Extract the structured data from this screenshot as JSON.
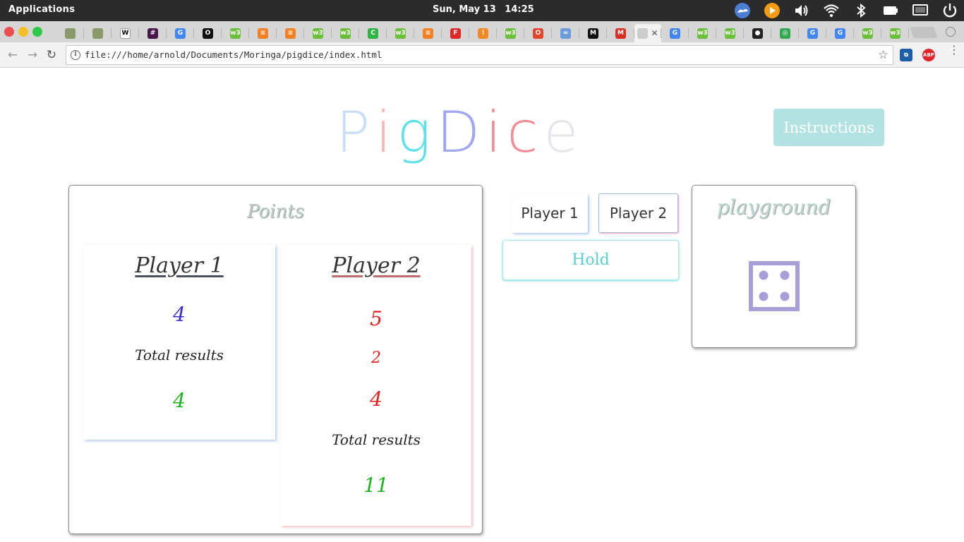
{
  "os": {
    "apps_label": "Applications",
    "date": "Sun, May 13",
    "time": "14:25",
    "tray_icons": [
      "weather-icon",
      "media-player-icon",
      "volume-icon",
      "wifi-icon",
      "bluetooth-icon",
      "battery-icon",
      "display-icon",
      "power-icon"
    ]
  },
  "browser": {
    "tab_favicons": [
      {
        "icon": "tree-icon",
        "color": "#8a9a6a",
        "text": ""
      },
      {
        "icon": "tree-icon",
        "color": "#8a9a6a",
        "text": ""
      },
      {
        "icon": "wikipedia-icon",
        "color": "#ffffff",
        "text": "W"
      },
      {
        "icon": "slack-icon",
        "color": "#4a154b",
        "text": "#"
      },
      {
        "icon": "google-icon",
        "color": "#4285f4",
        "text": "G"
      },
      {
        "icon": "obs-icon",
        "color": "#111111",
        "text": "O"
      },
      {
        "icon": "w3schools-icon",
        "color": "#6bbf3b",
        "text": "w3"
      },
      {
        "icon": "stackoverflow-icon",
        "color": "#f48024",
        "text": "≡"
      },
      {
        "icon": "stackoverflow-icon",
        "color": "#f48024",
        "text": "≡"
      },
      {
        "icon": "w3schools-icon",
        "color": "#6bbf3b",
        "text": "w3"
      },
      {
        "icon": "w3schools-icon",
        "color": "#6bbf3b",
        "text": "w3"
      },
      {
        "icon": "codecademy-icon",
        "color": "#2fb344",
        "text": "C"
      },
      {
        "icon": "w3schools-icon",
        "color": "#6bbf3b",
        "text": "w3"
      },
      {
        "icon": "stackoverflow-icon",
        "color": "#f48024",
        "text": "≡"
      },
      {
        "icon": "flipboard-icon",
        "color": "#e12828",
        "text": "F"
      },
      {
        "icon": "bottle-icon",
        "color": "#f08a24",
        "text": "!"
      },
      {
        "icon": "w3schools-icon",
        "color": "#6bbf3b",
        "text": "w3"
      },
      {
        "icon": "opera-icon",
        "color": "#e4452f",
        "text": "O"
      },
      {
        "icon": "cloud-icon",
        "color": "#6b9bd8",
        "text": "∞"
      },
      {
        "icon": "medium-icon",
        "color": "#111111",
        "text": "M"
      },
      {
        "icon": "gmail-icon",
        "color": "#d93025",
        "text": "M"
      },
      {
        "icon": "blank-icon",
        "color": "#cccccc",
        "text": ""
      },
      {
        "icon": "google-icon",
        "color": "#4285f4",
        "text": "G"
      },
      {
        "icon": "w3schools-icon",
        "color": "#6bbf3b",
        "text": "w3"
      },
      {
        "icon": "w3schools-icon",
        "color": "#6bbf3b",
        "text": "w3"
      },
      {
        "icon": "github-icon",
        "color": "#222222",
        "text": "●"
      },
      {
        "icon": "chrome-icon",
        "color": "#34a853",
        "text": "◎"
      },
      {
        "icon": "google-icon",
        "color": "#4285f4",
        "text": "G"
      },
      {
        "icon": "google-icon",
        "color": "#4285f4",
        "text": "G"
      },
      {
        "icon": "w3schools-icon",
        "color": "#6bbf3b",
        "text": "w3"
      },
      {
        "icon": "w3schools-icon",
        "color": "#6bbf3b",
        "text": "w3"
      }
    ],
    "active_tab_index": 21,
    "url": "file:///home/arnold/Documents/Moringa/pigdice/index.html",
    "extensions": [
      {
        "icon": "extension-icon",
        "color": "#1e5ea8",
        "text": "⧉"
      },
      {
        "icon": "adblock-icon",
        "color": "#e0262d",
        "text": "ABP"
      }
    ]
  },
  "page": {
    "title_letters": [
      {
        "char": "P",
        "color": "#c9def8"
      },
      {
        "char": "i",
        "color": "#ffb3b3"
      },
      {
        "char": "g",
        "color": "#5ee0ea"
      },
      {
        "char": "D",
        "color": "#a0a6f0"
      },
      {
        "char": "i",
        "color": "#f28b94"
      },
      {
        "char": "c",
        "color": "#f28b94"
      },
      {
        "char": "e",
        "color": "#e4e6ea"
      }
    ],
    "instructions_label": "Instructions",
    "points": {
      "title": "Points",
      "player1": {
        "heading": "Player 1",
        "rolls": [
          "4"
        ],
        "total_label": "Total results",
        "total": "4"
      },
      "player2": {
        "heading": "Player 2",
        "rolls": [
          "5",
          "2",
          "4"
        ],
        "total_label": "Total results",
        "total": "11"
      }
    },
    "controls": {
      "player1_label": "Player 1",
      "player2_label": "Player 2",
      "hold_label": "Hold"
    },
    "playground": {
      "title": "playground",
      "die_value": 4,
      "die_color": "#a99fd8"
    },
    "colors": {
      "p1_roll": "#3a2fd0",
      "p2_roll": "#e02424",
      "total": "#1db31d"
    }
  }
}
